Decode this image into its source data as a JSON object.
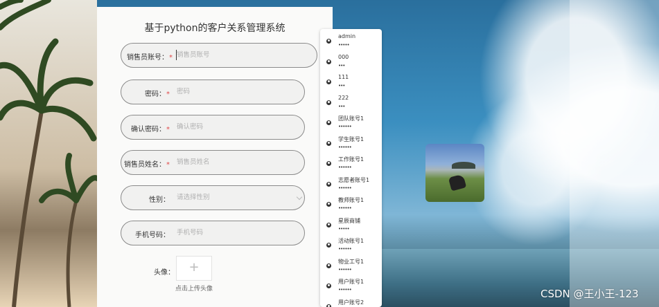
{
  "form": {
    "title": "基于python的客户关系管理系统",
    "fields": [
      {
        "label": "销售员账号",
        "required": "*",
        "placeholder": "销售员账号"
      },
      {
        "label": "密码",
        "required": "*",
        "placeholder": "密码"
      },
      {
        "label": "确认密码",
        "required": "*",
        "placeholder": "确认密码"
      },
      {
        "label": "销售员姓名",
        "required": "*",
        "placeholder": "销售员姓名"
      },
      {
        "label": "性别",
        "required": "",
        "placeholder": "请选择性别"
      },
      {
        "label": "手机号码",
        "required": "",
        "placeholder": "手机号码"
      }
    ],
    "colon": "：",
    "avatar_label": "头像：",
    "upload_plus": "+",
    "upload_hint": "点击上传头像"
  },
  "saved_accounts": [
    {
      "name": "admin",
      "password": "•••••"
    },
    {
      "name": "000",
      "password": "•••"
    },
    {
      "name": "111",
      "password": "•••"
    },
    {
      "name": "222",
      "password": "•••"
    },
    {
      "name": "团队账号1",
      "password": "••••••"
    },
    {
      "name": "学生账号1",
      "password": "••••••"
    },
    {
      "name": "工作账号1",
      "password": "••••••"
    },
    {
      "name": "志愿者账号1",
      "password": "••••••"
    },
    {
      "name": "教师账号1",
      "password": "••••••"
    },
    {
      "name": "星辰商铺",
      "password": "•••••"
    },
    {
      "name": "活动账号1",
      "password": "••••••"
    },
    {
      "name": "物业工号1",
      "password": "••••••"
    },
    {
      "name": "用户账号1",
      "password": "••••••"
    },
    {
      "name": "用户账号2",
      "password": "••••••"
    }
  ],
  "watermark": "CSDN @王小王-123",
  "colors": {
    "required": "#e04848",
    "field_border": "#8a8a8a",
    "card_bg": "#fafaf9"
  }
}
